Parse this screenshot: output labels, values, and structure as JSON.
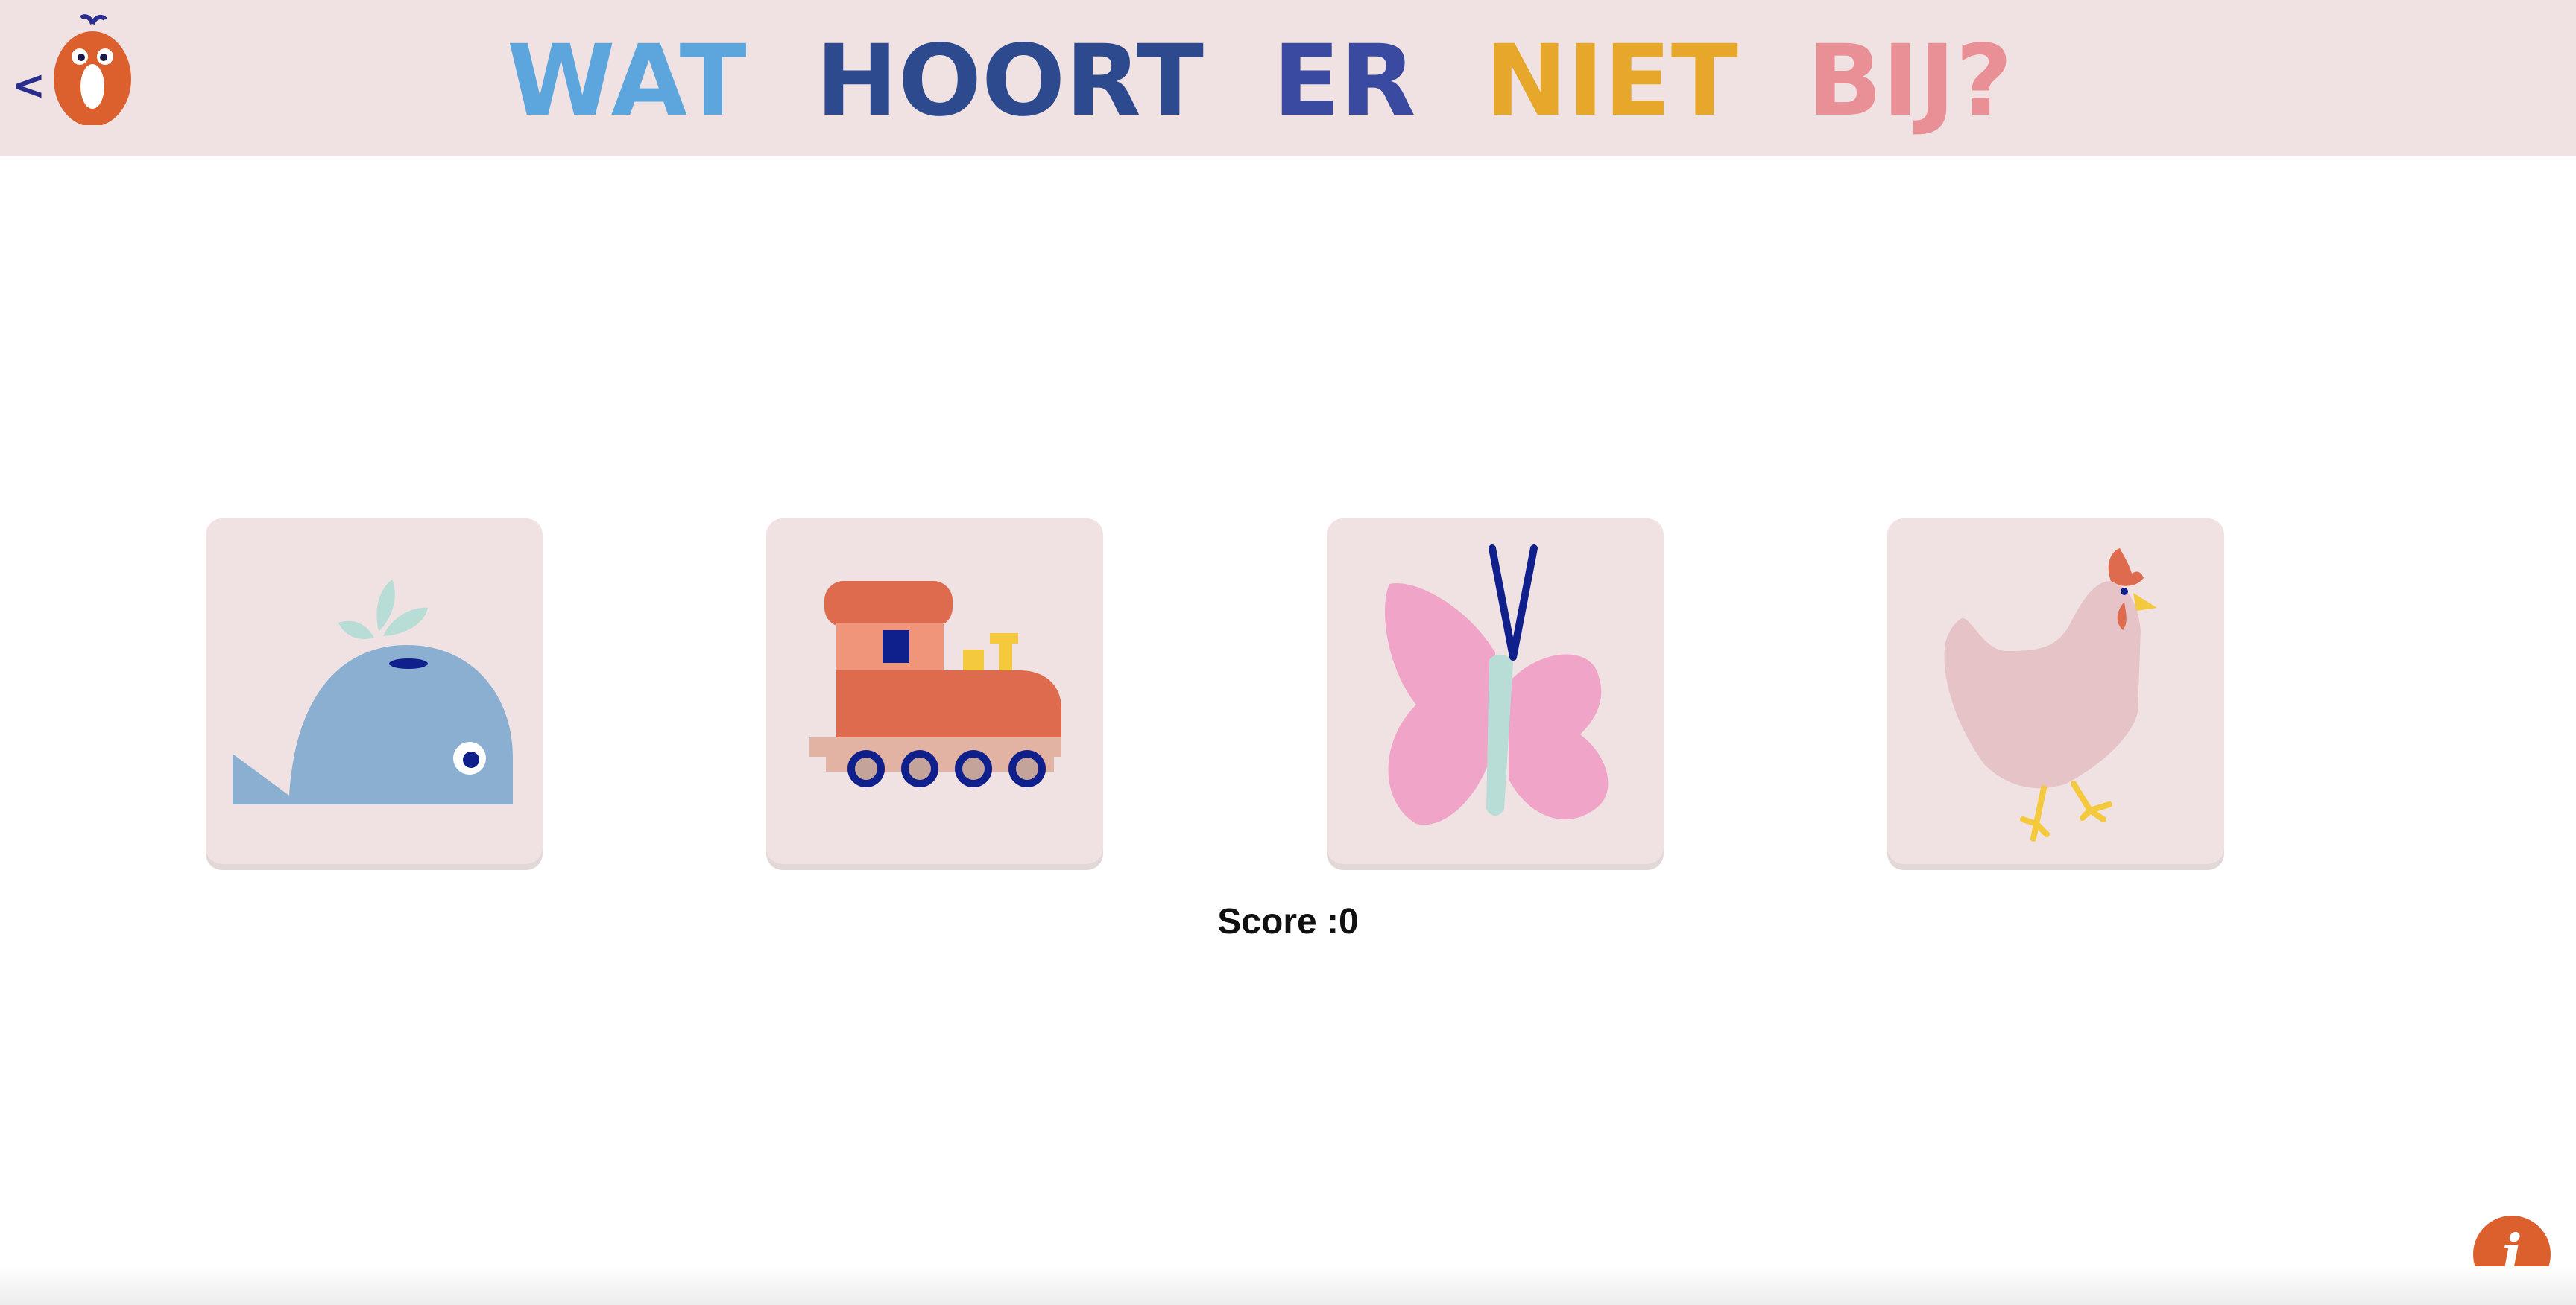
{
  "header": {
    "back_label": "<",
    "title_words": [
      "WAT",
      "HOORT",
      "ER",
      "NIET",
      "BIJ?"
    ]
  },
  "cards": [
    {
      "name": "whale",
      "icon": "whale-icon"
    },
    {
      "name": "train",
      "icon": "train-icon"
    },
    {
      "name": "butterfly",
      "icon": "butterfly-icon"
    },
    {
      "name": "chicken",
      "icon": "chicken-icon"
    }
  ],
  "score": {
    "label": "Score :0"
  },
  "info_button": {
    "label": "i"
  },
  "colors": {
    "header_bg": "#f0e2e2",
    "card_bg": "#f0e2e2",
    "accent_orange": "#dc5f2e",
    "navy": "#2a2f8f"
  }
}
